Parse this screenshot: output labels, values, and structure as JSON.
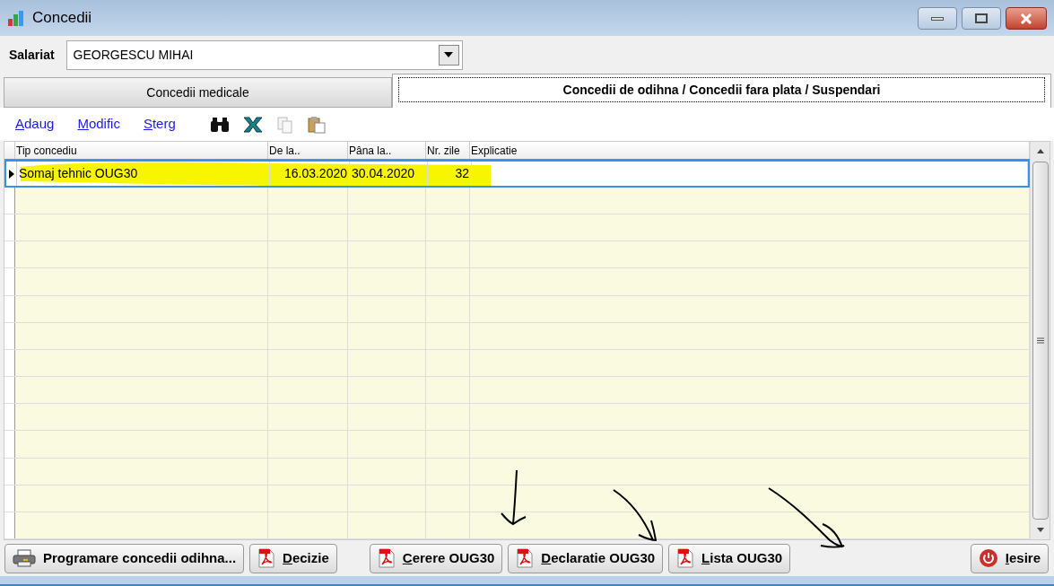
{
  "window": {
    "title": "Concedii"
  },
  "employee": {
    "label": "Salariat",
    "value": "GEORGESCU MIHAI"
  },
  "tabs": [
    {
      "label": "Concedii medicale",
      "selected": false
    },
    {
      "label": "Concedii de odihna / Concedii fara plata / Suspendari",
      "selected": true
    }
  ],
  "toolbar": {
    "links": [
      "Adaug",
      "Modific",
      "Sterg"
    ]
  },
  "table": {
    "columns": [
      "Tip concediu",
      "De la..",
      "Pâna la..",
      "Nr. zile",
      "Explicatie"
    ],
    "rows": [
      {
        "cells": [
          "Somaj tehnic OUG30",
          "16.03.2020",
          "30.04.2020",
          "32",
          ""
        ],
        "selected": true
      }
    ]
  },
  "buttons": [
    {
      "label": "Programare concedii odihna...",
      "kind": "print",
      "accel": false
    },
    {
      "label": "Decizie",
      "kind": "pdf",
      "accel": true
    },
    {
      "label": "Cerere OUG30",
      "kind": "pdf",
      "accel": true
    },
    {
      "label": "Declaratie OUG30",
      "kind": "pdf",
      "accel": true
    },
    {
      "label": "Lista OUG30",
      "kind": "pdf",
      "accel": true
    },
    {
      "label": "Iesire",
      "kind": "exit",
      "accel": true
    }
  ]
}
